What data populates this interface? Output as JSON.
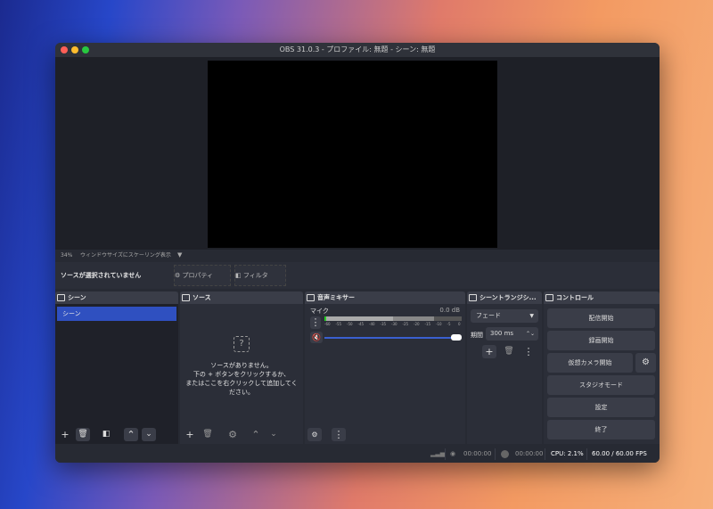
{
  "window": {
    "title": "OBS 31.0.3 - プロファイル: 無題 - シーン: 無題"
  },
  "scale": {
    "zoom": "34%",
    "mode": "ウィンドウサイズにスケーリング表示"
  },
  "context": {
    "status": "ソースが選択されていません",
    "properties": "プロパティ",
    "filters": "フィルタ"
  },
  "scenes": {
    "title": "シーン",
    "items": [
      "シーン"
    ]
  },
  "sources": {
    "title": "ソース",
    "empty": "ソースがありません。\n下の + ボタンをクリックするか、\nまたはここを右クリックして追加してください。"
  },
  "mixer": {
    "title": "音声ミキサー",
    "channel": "マイク",
    "level": "0.0 dB",
    "ticks": [
      "-60",
      "-55",
      "-50",
      "-45",
      "-40",
      "-35",
      "-30",
      "-25",
      "-20",
      "-15",
      "-10",
      "-5",
      "0"
    ],
    "volume_percent": 100,
    "muted": true
  },
  "transitions": {
    "title": "シーントランジシ...",
    "type": "フェード",
    "duration_label": "期間",
    "duration": "300 ms"
  },
  "controls": {
    "title": "コントロール",
    "start_streaming": "配信開始",
    "start_recording": "録画開始",
    "start_virtualcam": "仮想カメラ開始",
    "studio_mode": "スタジオモード",
    "settings": "設定",
    "exit": "終了"
  },
  "statusbar": {
    "stream_time": "00:00:00",
    "record_time": "00:00:00",
    "cpu": "CPU: 2.1%",
    "fps": "60.00 / 60.00 FPS"
  }
}
